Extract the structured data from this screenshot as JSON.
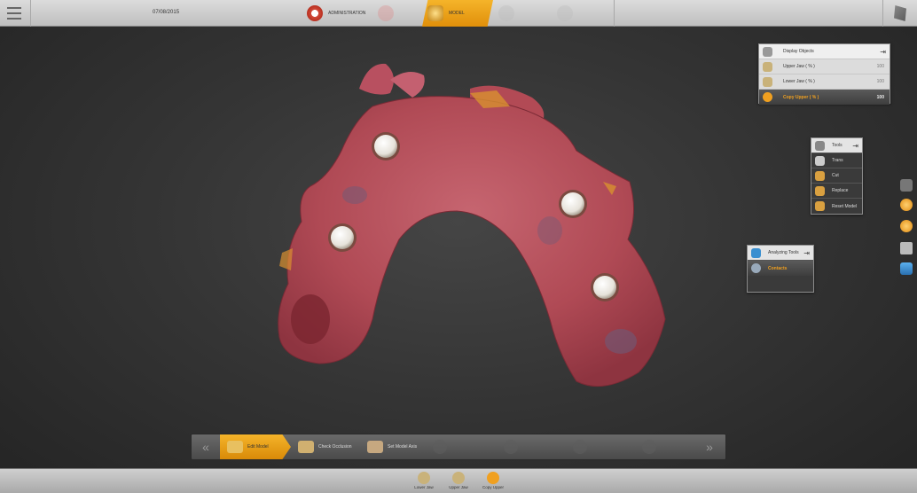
{
  "topbar": {
    "date": "07/08/2015",
    "steps": [
      {
        "label": "ADMINISTRATION",
        "state": "done"
      },
      {
        "label": "",
        "state": "faded"
      },
      {
        "label": "MODEL",
        "state": "active"
      },
      {
        "label": "",
        "state": "faded"
      },
      {
        "label": "",
        "state": "faded"
      }
    ]
  },
  "display_panel": {
    "title": "Display Objects",
    "rows": [
      {
        "label": "Upper Jaw ( % )",
        "value": "100"
      },
      {
        "label": "Lower Jaw ( % )",
        "value": "100"
      },
      {
        "label": "Copy Upper ( % )",
        "value": "100"
      }
    ]
  },
  "tools_panel": {
    "title": "Tools",
    "items": [
      "Trans",
      "Cut",
      "Replace",
      "Reset Model"
    ]
  },
  "analyzing_panel": {
    "title": "Analyzing Tools",
    "items": [
      "Contacts"
    ]
  },
  "wizard": {
    "steps": [
      "Edit Model",
      "Check Occlusion",
      "Set Model Axis"
    ]
  },
  "bottombar": {
    "items": [
      "Lower Jaw",
      "Upper Jaw",
      "Copy Upper"
    ]
  },
  "colors": {
    "accent": "#f0a020",
    "gum": "#b24a55",
    "implant": "#efefef"
  }
}
